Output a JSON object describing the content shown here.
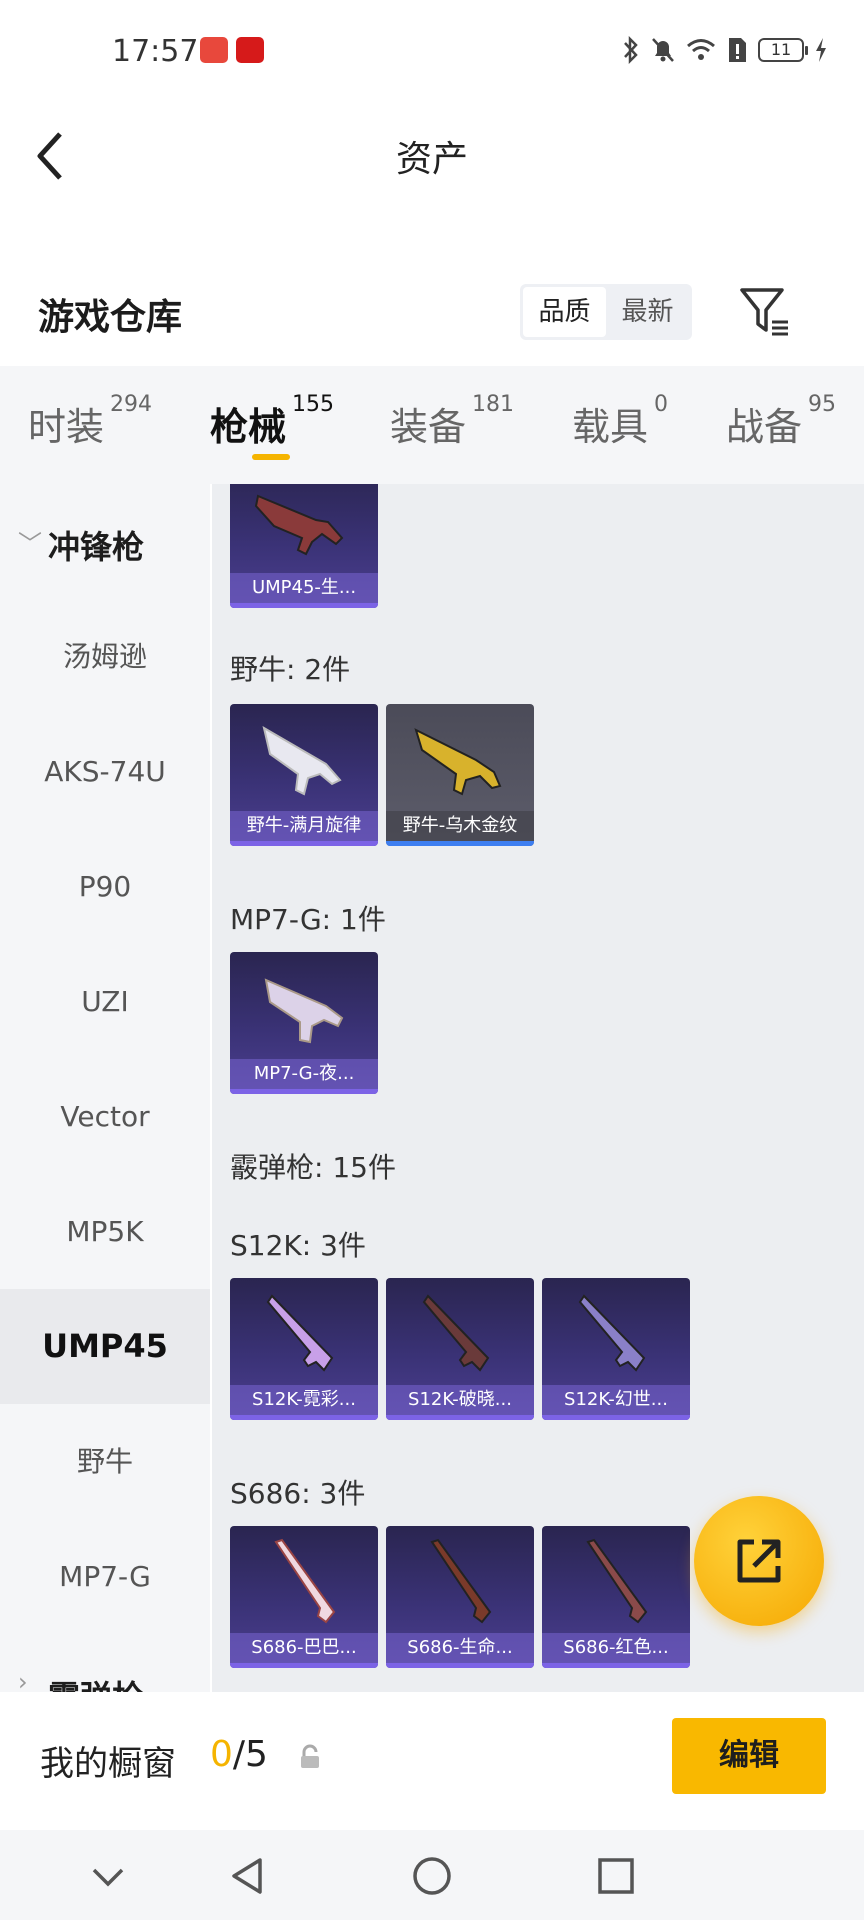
{
  "status_bar": {
    "time": "17:57",
    "battery": "11"
  },
  "header": {
    "title": "资产"
  },
  "warehouse": {
    "title": "游戏仓库",
    "sort_options": [
      "品质",
      "最新"
    ],
    "active_sort": "品质"
  },
  "tabs": [
    {
      "label": "时装",
      "count": "294"
    },
    {
      "label": "枪械",
      "count": "155",
      "active": true
    },
    {
      "label": "装备",
      "count": "181"
    },
    {
      "label": "载具",
      "count": "0"
    },
    {
      "label": "战备",
      "count": "95"
    }
  ],
  "sidebar": {
    "category": "冲锋枪",
    "items": [
      "汤姆逊",
      "AKS-74U",
      "P90",
      "UZI",
      "Vector",
      "MP5K",
      "UMP45",
      "野牛",
      "MP7-G"
    ],
    "active_item": "UMP45",
    "next_category": "霰弹枪"
  },
  "groups": [
    {
      "title": "",
      "cards": [
        {
          "name": "UMP45-生...",
          "style": "purple"
        }
      ]
    },
    {
      "title": "野牛: 2件",
      "cards": [
        {
          "name": "野牛-满月旋律",
          "style": "purple"
        },
        {
          "name": "野牛-乌木金纹",
          "style": "gold"
        }
      ]
    },
    {
      "title": "MP7-G: 1件",
      "cards": [
        {
          "name": "MP7-G-夜...",
          "style": "purple"
        }
      ]
    },
    {
      "title": "霰弹枪: 15件",
      "cards": []
    },
    {
      "title": "S12K: 3件",
      "cards": [
        {
          "name": "S12K-霓彩...",
          "style": "purple"
        },
        {
          "name": "S12K-破晓...",
          "style": "purple"
        },
        {
          "name": "S12K-幻世...",
          "style": "purple"
        }
      ]
    },
    {
      "title": "S686: 3件",
      "cards": [
        {
          "name": "S686-巴巴...",
          "style": "purple"
        },
        {
          "name": "S686-生命...",
          "style": "purple"
        },
        {
          "name": "S686-红色...",
          "style": "purple"
        }
      ]
    }
  ],
  "showcase": {
    "label": "我的橱窗",
    "current": "0",
    "total": "/5",
    "edit_label": "编辑"
  },
  "colors": {
    "accent": "#f5b400",
    "card_purple": "#3a3276",
    "card_bar": "#7c63e6",
    "card_gold_bar": "#3d7ef0"
  }
}
